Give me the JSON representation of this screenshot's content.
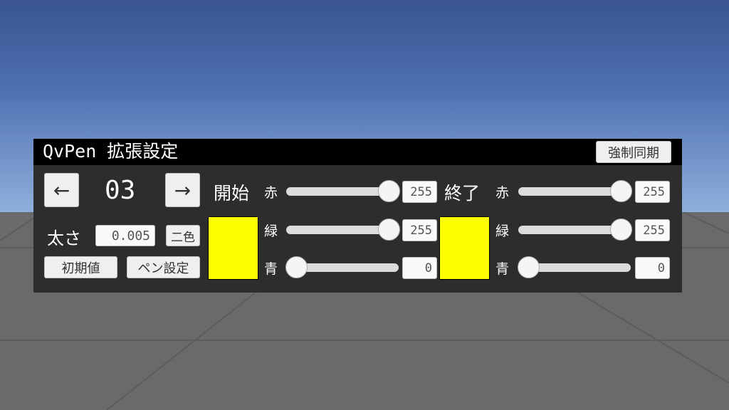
{
  "title": "QvPen 拡張設定",
  "force_sync_label": "強制同期",
  "pen": {
    "prev_label": "←",
    "next_label": "→",
    "index": "03",
    "width_label": "太さ",
    "width_value": "0.005",
    "two_color_label": "二色",
    "reset_label": "初期値",
    "pen_settings_label": "ペン設定"
  },
  "start": {
    "label": "開始",
    "color": "#ffff00",
    "channels": [
      {
        "label": "赤",
        "value": 255
      },
      {
        "label": "緑",
        "value": 255
      },
      {
        "label": "青",
        "value": 0
      }
    ]
  },
  "end": {
    "label": "終了",
    "color": "#ffff00",
    "channels": [
      {
        "label": "赤",
        "value": 255
      },
      {
        "label": "緑",
        "value": 255
      },
      {
        "label": "青",
        "value": 0
      }
    ]
  }
}
